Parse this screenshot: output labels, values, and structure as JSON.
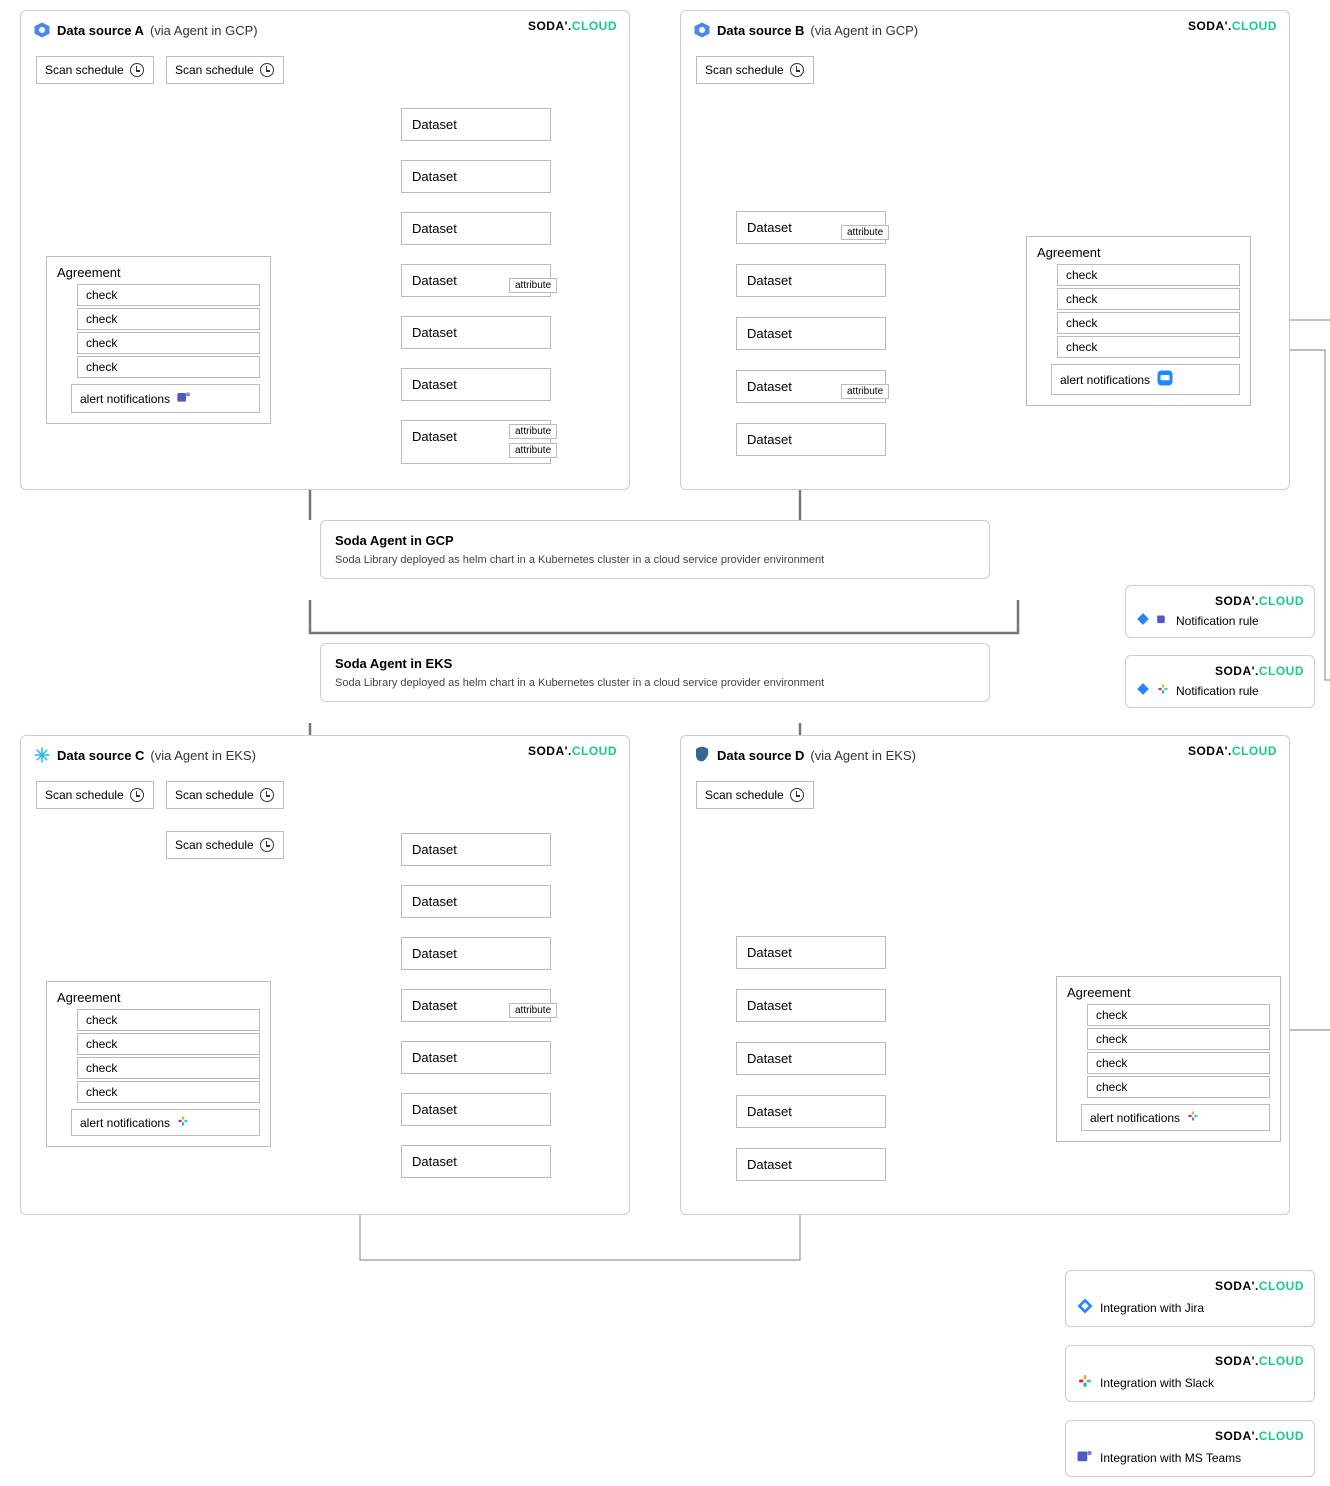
{
  "logo": {
    "dark": "SODA",
    "sep": "'.",
    "green": "CLOUD"
  },
  "sources": {
    "a": {
      "title": "Data source A",
      "sub": "(via Agent in GCP)",
      "scans": [
        "Scan schedule",
        "Scan schedule"
      ],
      "agreement": {
        "title": "Agreement",
        "checks": [
          "check",
          "check",
          "check",
          "check"
        ],
        "alert": "alert notifications"
      },
      "datasets": [
        "Dataset",
        "Dataset",
        "Dataset",
        "Dataset",
        "Dataset",
        "Dataset",
        "Dataset"
      ],
      "attrs": {
        "3": [
          "attribute"
        ],
        "6": [
          "attribute",
          "attribute"
        ]
      }
    },
    "b": {
      "title": "Data source B",
      "sub": "(via Agent in GCP)",
      "scans": [
        "Scan schedule"
      ],
      "agreement": {
        "title": "Agreement",
        "checks": [
          "check",
          "check",
          "check",
          "check"
        ],
        "alert": "alert notifications"
      },
      "datasets": [
        "Dataset",
        "Dataset",
        "Dataset",
        "Dataset",
        "Dataset"
      ],
      "attrs": {
        "0": [
          "attribute"
        ],
        "3": [
          "attribute"
        ]
      }
    },
    "c": {
      "title": "Data source C",
      "sub": "(via Agent in EKS)",
      "scans": [
        "Scan schedule",
        "Scan schedule",
        "Scan schedule"
      ],
      "agreement": {
        "title": "Agreement",
        "checks": [
          "check",
          "check",
          "check",
          "check"
        ],
        "alert": "alert notifications"
      },
      "datasets": [
        "Dataset",
        "Dataset",
        "Dataset",
        "Dataset",
        "Dataset",
        "Dataset",
        "Dataset"
      ],
      "attrs": {
        "3": [
          "attribute"
        ]
      }
    },
    "d": {
      "title": "Data source D",
      "sub": "(via Agent in EKS)",
      "scans": [
        "Scan schedule"
      ],
      "agreement": {
        "title": "Agreement",
        "checks": [
          "check",
          "check",
          "check",
          "check"
        ],
        "alert": "alert notifications"
      },
      "datasets": [
        "Dataset",
        "Dataset",
        "Dataset",
        "Dataset",
        "Dataset"
      ]
    }
  },
  "agents": {
    "gcp": {
      "title": "Soda Agent in GCP",
      "desc": "Soda Library deployed as helm chart in a Kubernetes cluster in a cloud service provider environment"
    },
    "eks": {
      "title": "Soda Agent in EKS",
      "desc": "Soda Library deployed as helm chart in a Kubernetes cluster in a cloud service provider environment"
    }
  },
  "notif": {
    "rule": "Notification rule"
  },
  "integrations": {
    "jira": "Integration with Jira",
    "slack": "Integration with Slack",
    "teams": "Integration with MS Teams"
  }
}
